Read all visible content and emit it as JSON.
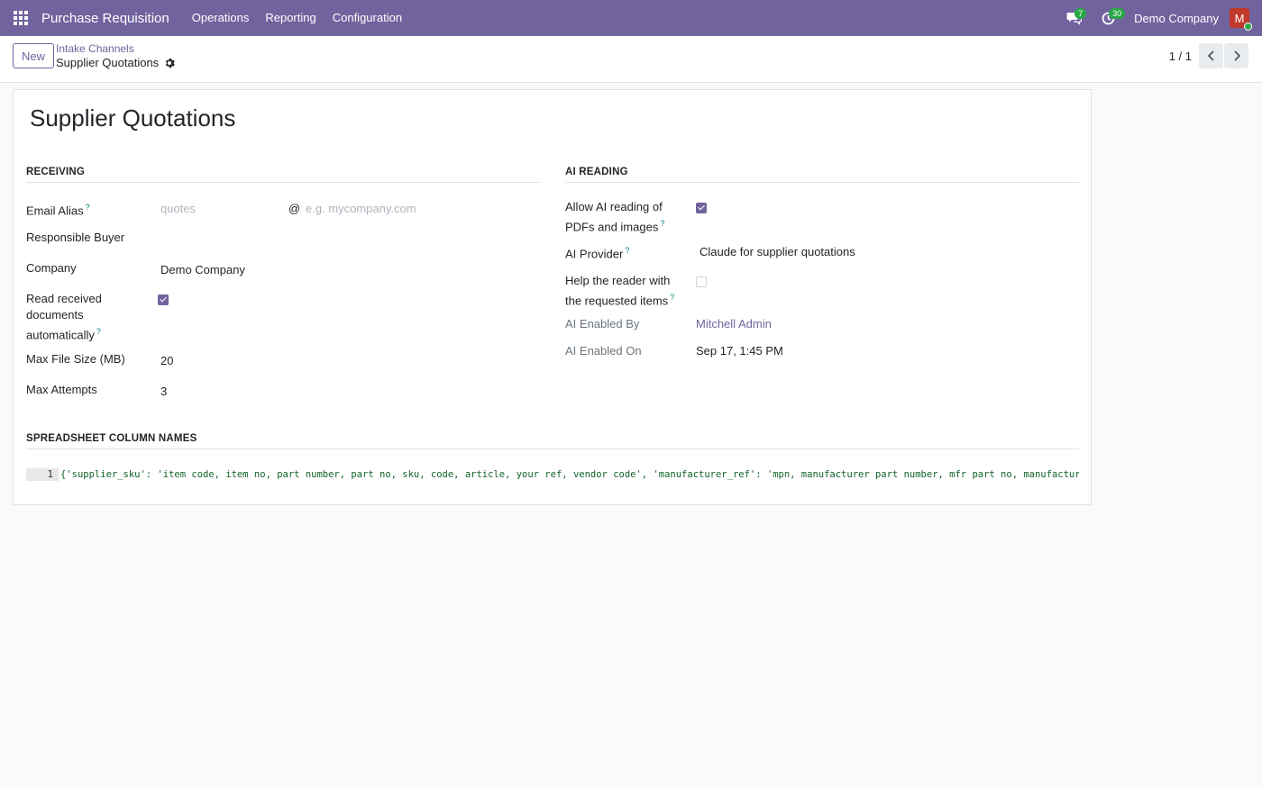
{
  "navbar": {
    "app_title": "Purchase Requisition",
    "menu": [
      "Operations",
      "Reporting",
      "Configuration"
    ],
    "messages_count": "7",
    "activities_count": "30",
    "company": "Demo Company",
    "avatar_initial": "M"
  },
  "control_panel": {
    "new_label": "New",
    "breadcrumb_parent": "Intake Channels",
    "breadcrumb_current": "Supplier Quotations",
    "pager": "1 / 1"
  },
  "form": {
    "title": "Supplier Quotations",
    "receiving": {
      "section_title": "RECEIVING",
      "email_alias_label": "Email Alias",
      "email_alias_placeholder": "quotes",
      "at_sign": "@",
      "domain_placeholder": "e.g. mycompany.com",
      "responsible_buyer_label": "Responsible Buyer",
      "company_label": "Company",
      "company_value": "Demo Company",
      "read_auto_label_1": "Read received",
      "read_auto_label_2": "documents",
      "read_auto_label_3": "automatically",
      "read_auto_checked": true,
      "max_file_size_label": "Max File Size (MB)",
      "max_file_size_value": "20",
      "max_attempts_label": "Max Attempts",
      "max_attempts_value": "3"
    },
    "ai_reading": {
      "section_title": "AI READING",
      "allow_ai_label_1": "Allow AI reading of",
      "allow_ai_label_2": "PDFs and images",
      "allow_ai_checked": true,
      "provider_label": "AI Provider",
      "provider_value": "Claude for supplier quotations",
      "help_reader_label_1": "Help the reader with",
      "help_reader_label_2": "the requested items",
      "help_reader_checked": false,
      "enabled_by_label": "AI Enabled By",
      "enabled_by_value": "Mitchell Admin",
      "enabled_on_label": "AI Enabled On",
      "enabled_on_value": "Sep 17, 1:45 PM"
    },
    "spreadsheet": {
      "section_title": "SPREADSHEET COLUMN NAMES",
      "line_number": "1",
      "code": "{'supplier_sku': 'item code, item no, part number, part no, sku, code, article, your ref, vendor code', 'manufacturer_ref': 'mpn, manufacturer part number, mfr part no, manufacturer ref, oem n"
    }
  },
  "colors": {
    "brand": "#71639e",
    "help": "#017e84",
    "badge": "#28a745"
  }
}
